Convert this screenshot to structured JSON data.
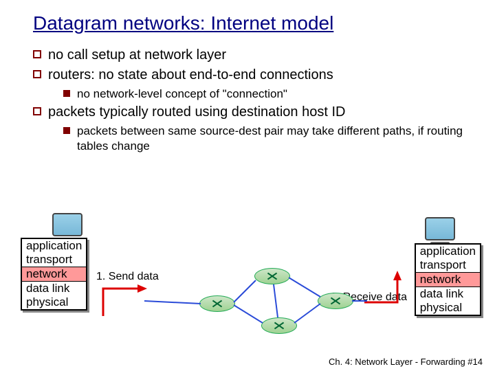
{
  "title": "Datagram networks: Internet model",
  "bullets": {
    "b1a": "no call setup at network layer",
    "b1b": "routers: no state about end-to-end connections",
    "b2a": "no network-level concept of \"connection\"",
    "b1c": "packets typically routed using destination host ID",
    "b2b": "packets between same source-dest pair may take different paths, if routing tables change"
  },
  "stack": {
    "application": "application",
    "transport": "transport",
    "network": "network",
    "datalink": "data link",
    "physical": "physical"
  },
  "labels": {
    "send": "1. Send data",
    "receive": "2. Receive data"
  },
  "footer": "Ch. 4: Network Layer - Forwarding  #14"
}
